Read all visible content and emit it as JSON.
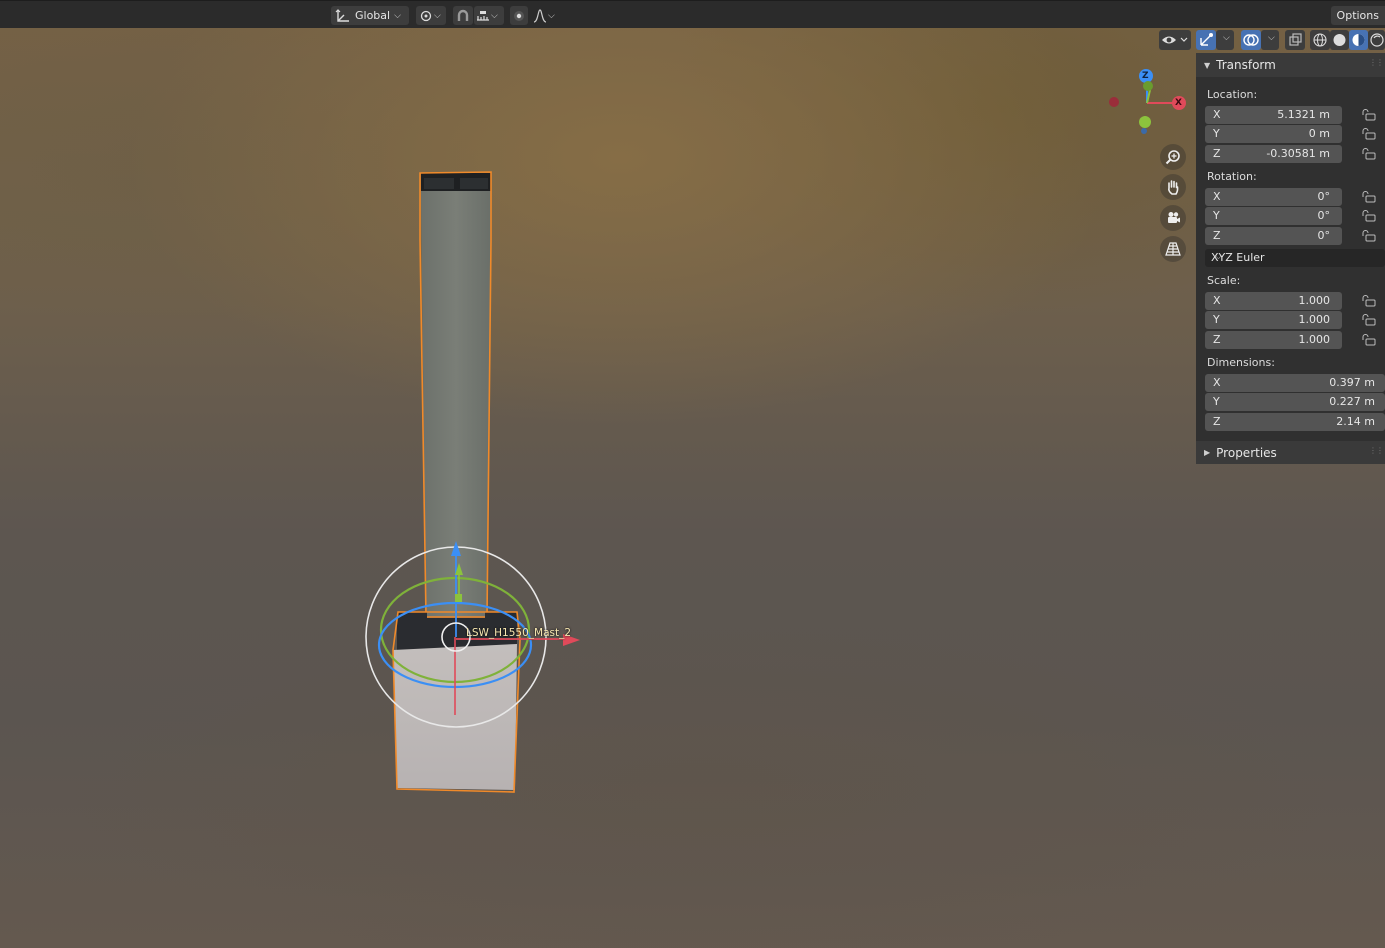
{
  "header": {
    "orientation": "Global",
    "options_label": "Options"
  },
  "object_name": "LSW_H1550_Mast_2",
  "gizmo_axes": {
    "z": "Z",
    "x": "X"
  },
  "npanel": {
    "transform_title": "Transform",
    "location": {
      "label": "Location:",
      "x_label": "X",
      "x": "5.1321 m",
      "y_label": "Y",
      "y": "0 m",
      "z_label": "Z",
      "z": "-0.30581 m"
    },
    "rotation": {
      "label": "Rotation:",
      "x_label": "X",
      "x": "0°",
      "y_label": "Y",
      "y": "0°",
      "z_label": "Z",
      "z": "0°"
    },
    "rotation_mode": "XYZ Euler",
    "scale": {
      "label": "Scale:",
      "x_label": "X",
      "x": "1.000",
      "y_label": "Y",
      "y": "1.000",
      "z_label": "Z",
      "z": "1.000"
    },
    "dimensions": {
      "label": "Dimensions:",
      "x_label": "X",
      "x": "0.397 m",
      "y_label": "Y",
      "y": "0.227 m",
      "z_label": "Z",
      "z": "2.14 m"
    },
    "properties_title": "Properties"
  },
  "colors": {
    "selection_outline": "#f08a2a",
    "axis_x": "#e04a5a",
    "axis_y": "#8cc33d",
    "axis_z": "#3b8ff5",
    "active_button": "#4772b3"
  }
}
